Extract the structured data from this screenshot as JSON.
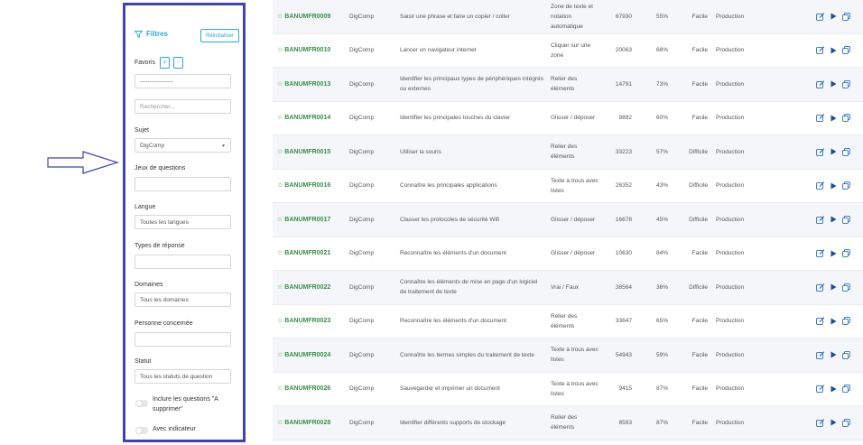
{
  "sidebar": {
    "title": "Filtres",
    "reset_label": "Réinitialiser",
    "favorites": {
      "label": "Favoris",
      "plus": "+",
      "minus": "-",
      "value": "-----------------"
    },
    "search_placeholder": "Rechercher...",
    "subject": {
      "label": "Sujet",
      "value": "DigComp"
    },
    "question_sets": {
      "label": "Jeux de questions",
      "value": ""
    },
    "language": {
      "label": "Langue",
      "value": "Toutes les langues"
    },
    "response_types": {
      "label": "Types de réponse",
      "value": ""
    },
    "domains": {
      "label": "Domaines",
      "value": "Tous les domaines"
    },
    "person": {
      "label": "Personne concernée",
      "value": ""
    },
    "status": {
      "label": "Statut",
      "value": "Tous les statuts de question"
    },
    "toggle_delete_label": "Inclure les questions \"A supprimer\"",
    "toggle_indicator_label": "Avec indicateur"
  },
  "rows": [
    {
      "code": "BANUMFR0009",
      "subject": "DigComp",
      "title": "Saisir une phrase et faire un copier / coller",
      "type": "Zone de texte et notation automatique",
      "count": "67930",
      "pct": "55%",
      "difficulty": "Facile",
      "status": "Production"
    },
    {
      "code": "BANUMFR0010",
      "subject": "DigComp",
      "title": "Lancer un navigateur internet",
      "type": "Cliquer sur une zone",
      "count": "20063",
      "pct": "68%",
      "difficulty": "Facile",
      "status": "Production"
    },
    {
      "code": "BANUMFR0013",
      "subject": "DigComp",
      "title": "Identifier les principaux types de périphériques intégrés ou externes",
      "type": "Relier des éléments",
      "count": "14791",
      "pct": "73%",
      "difficulty": "Facile",
      "status": "Production"
    },
    {
      "code": "BANUMFR0014",
      "subject": "DigComp",
      "title": "Identifier les principales touches du clavier",
      "type": "Glisser / déposer",
      "count": "9892",
      "pct": "60%",
      "difficulty": "Facile",
      "status": "Production"
    },
    {
      "code": "BANUMFR0015",
      "subject": "DigComp",
      "title": "Utiliser la souris",
      "type": "Relier des éléments",
      "count": "33223",
      "pct": "57%",
      "difficulty": "Difficile",
      "status": "Production"
    },
    {
      "code": "BANUMFR0016",
      "subject": "DigComp",
      "title": "Connaître les principales applications",
      "type": "Texte à trous avec listes",
      "count": "26352",
      "pct": "43%",
      "difficulty": "Difficile",
      "status": "Production"
    },
    {
      "code": "BANUMFR0017",
      "subject": "DigComp",
      "title": "Classer les protocoles de sécurité Wifi",
      "type": "Glisser / déposer",
      "count": "16678",
      "pct": "45%",
      "difficulty": "Difficile",
      "status": "Production"
    },
    {
      "code": "BANUMFR0021",
      "subject": "DigComp",
      "title": "Reconnaître les éléments d'un document",
      "type": "Glisser / déposer",
      "count": "10630",
      "pct": "84%",
      "difficulty": "Facile",
      "status": "Production"
    },
    {
      "code": "BANUMFR0022",
      "subject": "DigComp",
      "title": "Connaître les éléments de mise en page d'un logiciel de traitement de texte",
      "type": "Vrai / Faux",
      "count": "38564",
      "pct": "36%",
      "difficulty": "Difficile",
      "status": "Production"
    },
    {
      "code": "BANUMFR0023",
      "subject": "DigComp",
      "title": "Reconnaître les éléments d'un document",
      "type": "Relier des éléments",
      "count": "33647",
      "pct": "65%",
      "difficulty": "Facile",
      "status": "Production"
    },
    {
      "code": "BANUMFR0024",
      "subject": "DigComp",
      "title": "Connaître les termes simples du traitement de texte",
      "type": "Texte à trous avec listes",
      "count": "54943",
      "pct": "59%",
      "difficulty": "Facile",
      "status": "Production"
    },
    {
      "code": "BANUMFR0026",
      "subject": "DigComp",
      "title": "Sauvegarder et imprimer un document",
      "type": "Texte à trous avec listes",
      "count": "9415",
      "pct": "87%",
      "difficulty": "Facile",
      "status": "Production"
    },
    {
      "code": "BANUMFR0028",
      "subject": "DigComp",
      "title": "Identifier différents supports de stockage",
      "type": "Relier des éléments",
      "count": "8593",
      "pct": "87%",
      "difficulty": "Facile",
      "status": "Production"
    }
  ],
  "colors": {
    "accent": "#2fa5d6",
    "code_green": "#3b8f4a",
    "frame": "#3f43b8",
    "icon_blue": "#2a6fb5"
  },
  "icons": {
    "edit": "edit-icon",
    "play": "play-icon",
    "copy": "copy-icon",
    "star": "star-icon",
    "filter": "filter-icon"
  }
}
